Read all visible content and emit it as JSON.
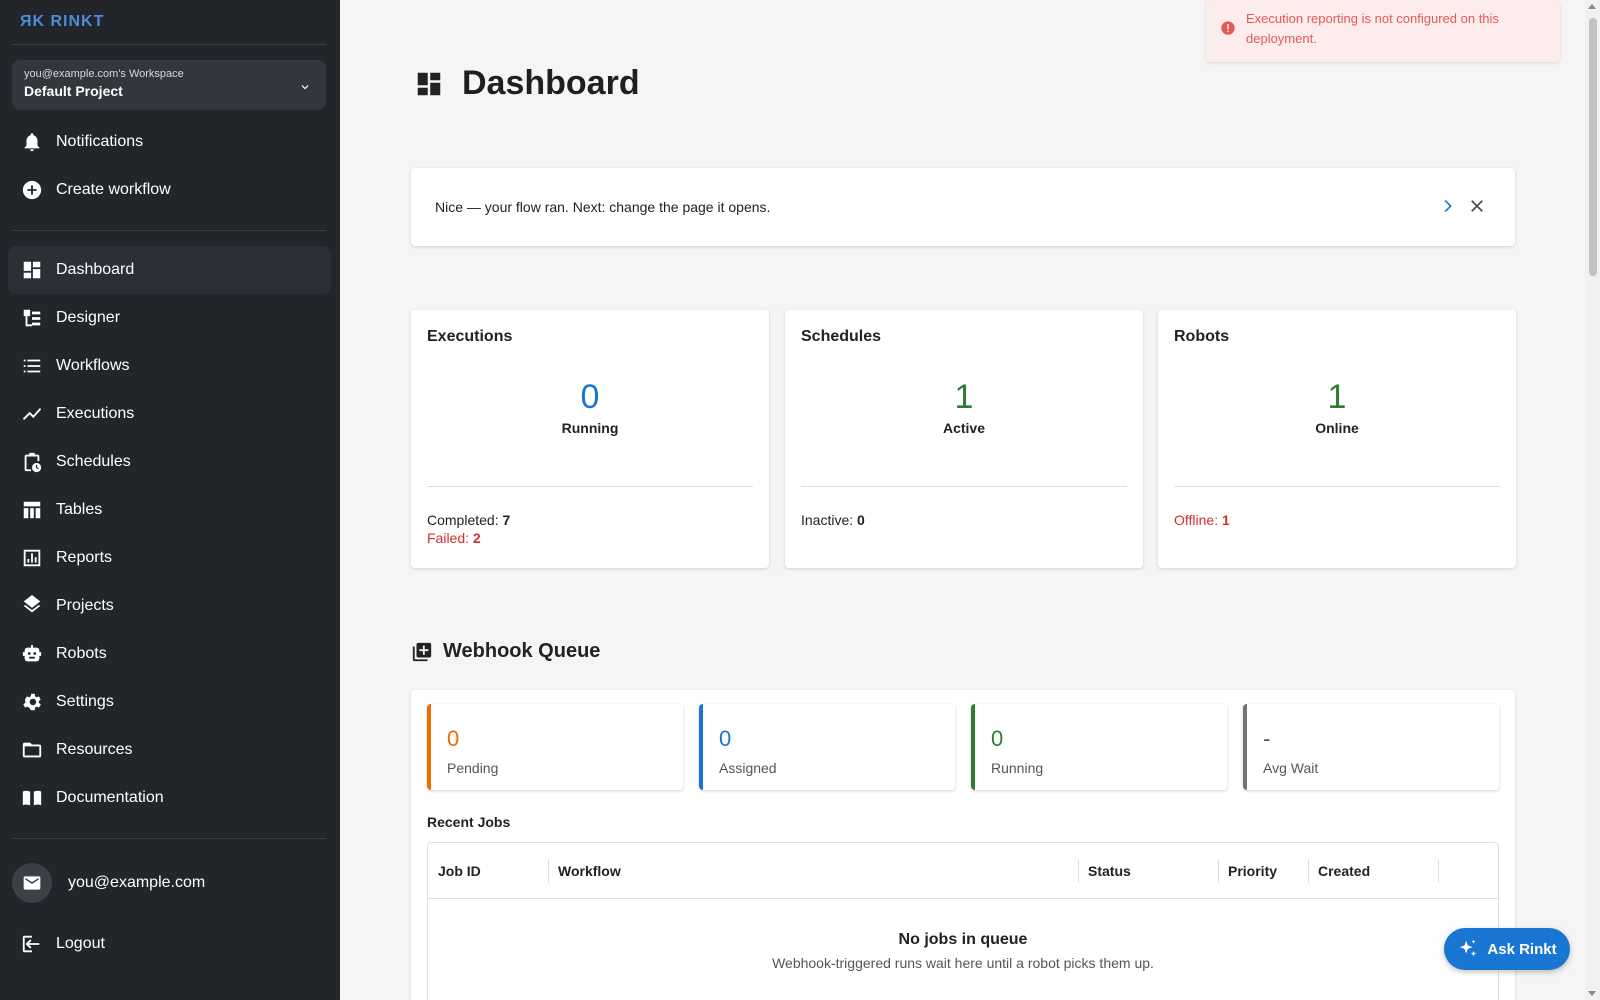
{
  "app": {
    "logo_text": "ЯK RINKT"
  },
  "workspace": {
    "owner": "you@example.com's Workspace",
    "project": "Default Project"
  },
  "sidebar": {
    "top_items": [
      {
        "label": "Notifications",
        "icon": "bell-icon"
      },
      {
        "label": "Create workflow",
        "icon": "add-circle-icon"
      }
    ],
    "items": [
      {
        "label": "Dashboard",
        "icon": "dashboard-icon",
        "active": true
      },
      {
        "label": "Designer",
        "icon": "designer-icon"
      },
      {
        "label": "Workflows",
        "icon": "list-icon"
      },
      {
        "label": "Executions",
        "icon": "trend-icon"
      },
      {
        "label": "Schedules",
        "icon": "schedule-icon"
      },
      {
        "label": "Tables",
        "icon": "table-icon"
      },
      {
        "label": "Reports",
        "icon": "report-icon"
      },
      {
        "label": "Projects",
        "icon": "layers-icon"
      },
      {
        "label": "Robots",
        "icon": "robot-icon"
      },
      {
        "label": "Settings",
        "icon": "gear-icon"
      },
      {
        "label": "Resources",
        "icon": "folder-icon"
      },
      {
        "label": "Documentation",
        "icon": "book-icon"
      }
    ],
    "user_email": "you@example.com",
    "logout_label": "Logout"
  },
  "page": {
    "title": "Dashboard"
  },
  "banner": {
    "text": "Nice — your flow ran. Next: change the page it opens."
  },
  "stats": {
    "executions": {
      "title": "Executions",
      "value": "0",
      "sublabel": "Running",
      "completed_label": "Completed:",
      "completed": "7",
      "failed_label": "Failed:",
      "failed": "2"
    },
    "schedules": {
      "title": "Schedules",
      "value": "1",
      "sublabel": "Active",
      "inactive_label": "Inactive:",
      "inactive": "0"
    },
    "robots": {
      "title": "Robots",
      "value": "1",
      "sublabel": "Online",
      "offline_label": "Offline:",
      "offline": "1"
    }
  },
  "webhook": {
    "title": "Webhook Queue",
    "cards": [
      {
        "value": "0",
        "label": "Pending",
        "color": "#ef6c00"
      },
      {
        "value": "0",
        "label": "Assigned",
        "color": "#1976d2"
      },
      {
        "value": "0",
        "label": "Running",
        "color": "#2e7d32"
      },
      {
        "value": "-",
        "label": "Avg Wait",
        "color": "#757575"
      }
    ],
    "recent_jobs_label": "Recent Jobs",
    "columns": [
      "Job ID",
      "Workflow",
      "Status",
      "Priority",
      "Created"
    ],
    "empty_title": "No jobs in queue",
    "empty_sub": "Webhook-triggered runs wait here until a robot picks them up."
  },
  "toast": {
    "text": "Execution reporting is not configured on this deployment."
  },
  "assistant": {
    "label": "Ask Rinkt"
  },
  "colors": {
    "accent": "#1976d2",
    "sidebar_bg": "#22252a",
    "error": "#d32f2f",
    "success": "#2e7d32",
    "warning": "#ef6c00"
  }
}
